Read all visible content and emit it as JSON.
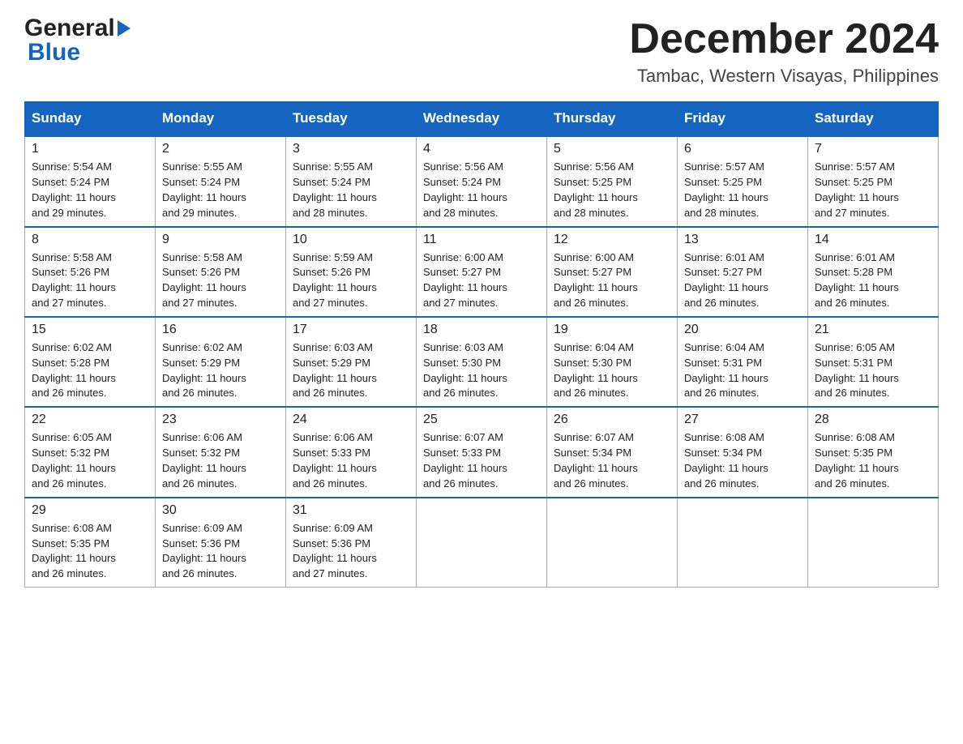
{
  "header": {
    "logo_general": "General",
    "logo_blue": "Blue",
    "month_title": "December 2024",
    "location": "Tambac, Western Visayas, Philippines"
  },
  "days_of_week": [
    "Sunday",
    "Monday",
    "Tuesday",
    "Wednesday",
    "Thursday",
    "Friday",
    "Saturday"
  ],
  "weeks": [
    [
      {
        "day": "1",
        "sunrise": "5:54 AM",
        "sunset": "5:24 PM",
        "daylight": "11 hours and 29 minutes."
      },
      {
        "day": "2",
        "sunrise": "5:55 AM",
        "sunset": "5:24 PM",
        "daylight": "11 hours and 29 minutes."
      },
      {
        "day": "3",
        "sunrise": "5:55 AM",
        "sunset": "5:24 PM",
        "daylight": "11 hours and 28 minutes."
      },
      {
        "day": "4",
        "sunrise": "5:56 AM",
        "sunset": "5:24 PM",
        "daylight": "11 hours and 28 minutes."
      },
      {
        "day": "5",
        "sunrise": "5:56 AM",
        "sunset": "5:25 PM",
        "daylight": "11 hours and 28 minutes."
      },
      {
        "day": "6",
        "sunrise": "5:57 AM",
        "sunset": "5:25 PM",
        "daylight": "11 hours and 28 minutes."
      },
      {
        "day": "7",
        "sunrise": "5:57 AM",
        "sunset": "5:25 PM",
        "daylight": "11 hours and 27 minutes."
      }
    ],
    [
      {
        "day": "8",
        "sunrise": "5:58 AM",
        "sunset": "5:26 PM",
        "daylight": "11 hours and 27 minutes."
      },
      {
        "day": "9",
        "sunrise": "5:58 AM",
        "sunset": "5:26 PM",
        "daylight": "11 hours and 27 minutes."
      },
      {
        "day": "10",
        "sunrise": "5:59 AM",
        "sunset": "5:26 PM",
        "daylight": "11 hours and 27 minutes."
      },
      {
        "day": "11",
        "sunrise": "6:00 AM",
        "sunset": "5:27 PM",
        "daylight": "11 hours and 27 minutes."
      },
      {
        "day": "12",
        "sunrise": "6:00 AM",
        "sunset": "5:27 PM",
        "daylight": "11 hours and 26 minutes."
      },
      {
        "day": "13",
        "sunrise": "6:01 AM",
        "sunset": "5:27 PM",
        "daylight": "11 hours and 26 minutes."
      },
      {
        "day": "14",
        "sunrise": "6:01 AM",
        "sunset": "5:28 PM",
        "daylight": "11 hours and 26 minutes."
      }
    ],
    [
      {
        "day": "15",
        "sunrise": "6:02 AM",
        "sunset": "5:28 PM",
        "daylight": "11 hours and 26 minutes."
      },
      {
        "day": "16",
        "sunrise": "6:02 AM",
        "sunset": "5:29 PM",
        "daylight": "11 hours and 26 minutes."
      },
      {
        "day": "17",
        "sunrise": "6:03 AM",
        "sunset": "5:29 PM",
        "daylight": "11 hours and 26 minutes."
      },
      {
        "day": "18",
        "sunrise": "6:03 AM",
        "sunset": "5:30 PM",
        "daylight": "11 hours and 26 minutes."
      },
      {
        "day": "19",
        "sunrise": "6:04 AM",
        "sunset": "5:30 PM",
        "daylight": "11 hours and 26 minutes."
      },
      {
        "day": "20",
        "sunrise": "6:04 AM",
        "sunset": "5:31 PM",
        "daylight": "11 hours and 26 minutes."
      },
      {
        "day": "21",
        "sunrise": "6:05 AM",
        "sunset": "5:31 PM",
        "daylight": "11 hours and 26 minutes."
      }
    ],
    [
      {
        "day": "22",
        "sunrise": "6:05 AM",
        "sunset": "5:32 PM",
        "daylight": "11 hours and 26 minutes."
      },
      {
        "day": "23",
        "sunrise": "6:06 AM",
        "sunset": "5:32 PM",
        "daylight": "11 hours and 26 minutes."
      },
      {
        "day": "24",
        "sunrise": "6:06 AM",
        "sunset": "5:33 PM",
        "daylight": "11 hours and 26 minutes."
      },
      {
        "day": "25",
        "sunrise": "6:07 AM",
        "sunset": "5:33 PM",
        "daylight": "11 hours and 26 minutes."
      },
      {
        "day": "26",
        "sunrise": "6:07 AM",
        "sunset": "5:34 PM",
        "daylight": "11 hours and 26 minutes."
      },
      {
        "day": "27",
        "sunrise": "6:08 AM",
        "sunset": "5:34 PM",
        "daylight": "11 hours and 26 minutes."
      },
      {
        "day": "28",
        "sunrise": "6:08 AM",
        "sunset": "5:35 PM",
        "daylight": "11 hours and 26 minutes."
      }
    ],
    [
      {
        "day": "29",
        "sunrise": "6:08 AM",
        "sunset": "5:35 PM",
        "daylight": "11 hours and 26 minutes."
      },
      {
        "day": "30",
        "sunrise": "6:09 AM",
        "sunset": "5:36 PM",
        "daylight": "11 hours and 26 minutes."
      },
      {
        "day": "31",
        "sunrise": "6:09 AM",
        "sunset": "5:36 PM",
        "daylight": "11 hours and 27 minutes."
      },
      null,
      null,
      null,
      null
    ]
  ],
  "labels": {
    "sunrise": "Sunrise:",
    "sunset": "Sunset:",
    "daylight": "Daylight:"
  }
}
